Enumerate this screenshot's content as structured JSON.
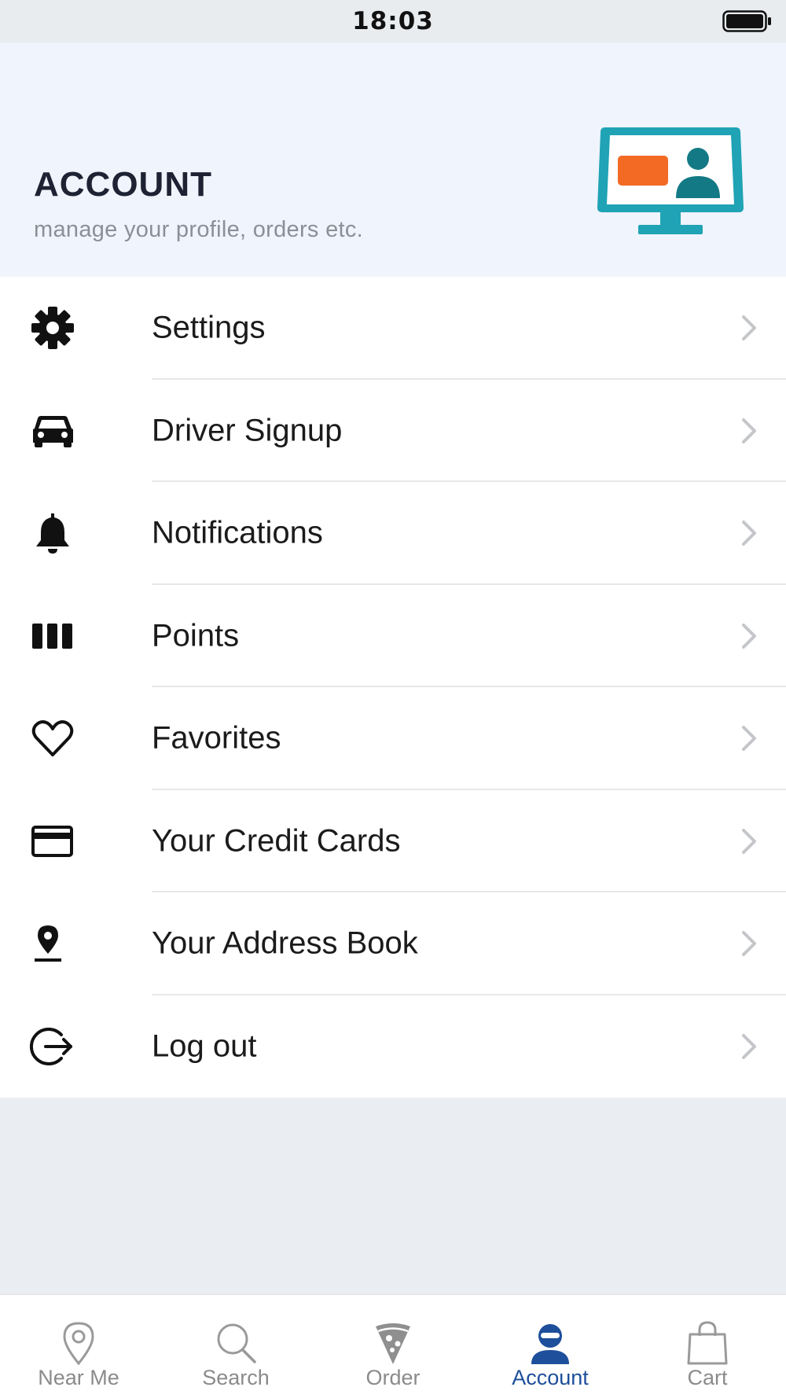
{
  "status_bar": {
    "time": "18:03"
  },
  "header": {
    "title": "ACCOUNT",
    "subtitle": "manage your profile, orders etc.",
    "illustration_icon": "monitor-profile-illustration",
    "colors": {
      "monitor": "#1fa3b5",
      "card": "#f26a24",
      "person": "#137a85"
    }
  },
  "menu": {
    "items": [
      {
        "label": "Settings",
        "icon": "gear-icon"
      },
      {
        "label": "Driver Signup",
        "icon": "car-icon"
      },
      {
        "label": "Notifications",
        "icon": "bell-icon"
      },
      {
        "label": "Points",
        "icon": "bars-icon"
      },
      {
        "label": "Favorites",
        "icon": "heart-icon"
      },
      {
        "label": "Your Credit Cards",
        "icon": "credit-card-icon"
      },
      {
        "label": "Your Address Book",
        "icon": "map-pin-icon"
      },
      {
        "label": "Log out",
        "icon": "logout-icon"
      }
    ]
  },
  "tab_bar": {
    "active": "Account",
    "active_color": "#1d4f9b",
    "tabs": [
      {
        "label": "Near Me",
        "icon": "location-pin-icon"
      },
      {
        "label": "Search",
        "icon": "search-icon"
      },
      {
        "label": "Order",
        "icon": "pizza-slice-icon"
      },
      {
        "label": "Account",
        "icon": "user-icon"
      },
      {
        "label": "Cart",
        "icon": "shopping-bag-icon"
      }
    ]
  }
}
